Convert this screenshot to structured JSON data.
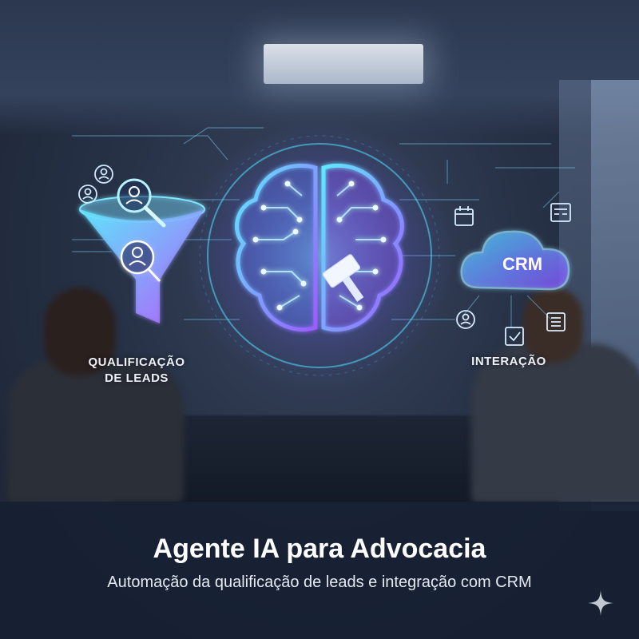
{
  "left_panel": {
    "label_line1": "QUALIFICAÇÃO",
    "label_line2": "DE LEADS",
    "icon": "funnel-icon"
  },
  "center": {
    "icon": "brain-circuit-icon",
    "secondary_icon": "gavel-icon"
  },
  "right_panel": {
    "cloud_text": "CRM",
    "label": "INTERAÇÃO",
    "icon": "cloud-icon"
  },
  "banner": {
    "title": "Agente IA para Advocacia",
    "subtitle": "Automação da qualificação de leads e integração com CRM"
  },
  "colors": {
    "cyan": "#4fe3ff",
    "violet": "#9b5cff",
    "banner_bg": "#16203280"
  }
}
